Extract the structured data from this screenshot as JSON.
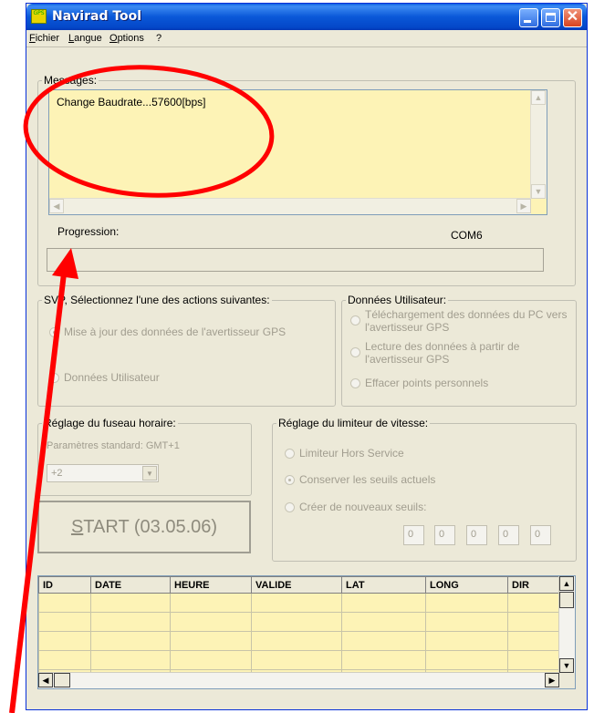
{
  "window": {
    "title": "Navirad Tool",
    "app_icon_text": "GPS",
    "close_glyph": "✕"
  },
  "menu": {
    "items": [
      "Fichier",
      "Langue",
      "Options",
      "?"
    ]
  },
  "messages": {
    "legend": "Messages:",
    "text": "Change Baudrate...57600[bps]"
  },
  "progress": {
    "label": "Progression:",
    "port": "COM6",
    "value_percent": 0
  },
  "actions": {
    "legend": "SVP, Sélectionnez l'une des actions suivantes:",
    "options": [
      "Mise à jour des données de l'avertisseur GPS",
      "Données Utilisateur"
    ],
    "selected_index": 0
  },
  "user_data": {
    "legend": "Données Utilisateur:",
    "options": [
      "Téléchargement des données du PC vers l'avertisseur GPS",
      "Lecture des données à partir de l'avertisseur GPS",
      "Effacer points personnels"
    ]
  },
  "timezone": {
    "legend": "Réglage du fuseau horaire:",
    "standard": "Paramètres standard: GMT+1",
    "value": "+2"
  },
  "speed_limiter": {
    "legend": "Réglage du limiteur de vitesse:",
    "options": [
      "Limiteur Hors Service",
      "Conserver les seuils actuels",
      "Créer de nouveaux seuils:"
    ],
    "selected_index": 1,
    "thresholds": [
      "0",
      "0",
      "0",
      "0",
      "0"
    ]
  },
  "start_button": {
    "label": "START (03.05.06)"
  },
  "table": {
    "columns": [
      "ID",
      "DATE",
      "HEURE",
      "VALIDE",
      "LAT",
      "LONG",
      "DIR"
    ],
    "empty_rows": 6
  },
  "colors": {
    "annotation": "#ff0000",
    "message_bg": "#fdf3b6",
    "window_bg": "#ece9d8",
    "title_blue": "#0a58d8"
  },
  "icons": [
    "app-icon",
    "minimize-icon",
    "maximize-icon",
    "close-icon",
    "scroll-up-arrow",
    "scroll-down-arrow",
    "scroll-left-arrow",
    "scroll-right-arrow",
    "dropdown-arrow"
  ]
}
